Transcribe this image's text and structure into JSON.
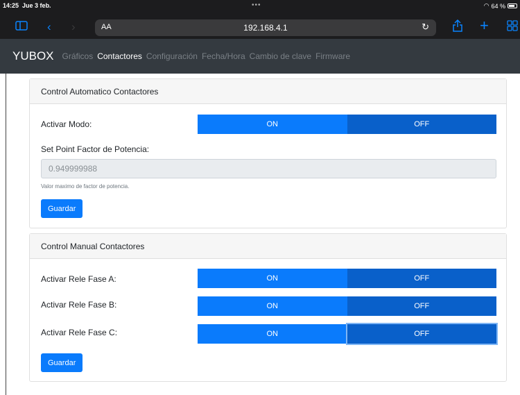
{
  "status": {
    "time": "14:25",
    "date": "Jue 3 feb.",
    "battery": "64 %"
  },
  "browser": {
    "aa_label": "AA",
    "url": "192.168.4.1"
  },
  "navbar": {
    "brand": "YUBOX",
    "links": [
      "Gráficos",
      "Contactores",
      "Configuración",
      "Fecha/Hora",
      "Cambio de clave",
      "Firmware"
    ],
    "active": "Contactores"
  },
  "auto_card": {
    "title": "Control Automatico Contactores",
    "mode_label": "Activar Modo:",
    "on_label": "ON",
    "off_label": "OFF",
    "setpoint_label": "Set Point Factor de Potencia:",
    "setpoint_value": "0.949999988",
    "help_text": "Valor maximo de factor de potencia.",
    "save_label": "Guardar"
  },
  "manual_card": {
    "title": "Control Manual Contactores",
    "phases": [
      {
        "label": "Activar Rele Fase A:",
        "on": "ON",
        "off": "OFF"
      },
      {
        "label": "Activar Rele Fase B:",
        "on": "ON",
        "off": "OFF"
      },
      {
        "label": "Activar Rele Fase C:",
        "on": "ON",
        "off": "OFF"
      }
    ],
    "save_label": "Guardar"
  },
  "colors": {
    "navbar": "#343a40",
    "primary": "#0a7bfc",
    "primary_dark": "#0960ca"
  }
}
